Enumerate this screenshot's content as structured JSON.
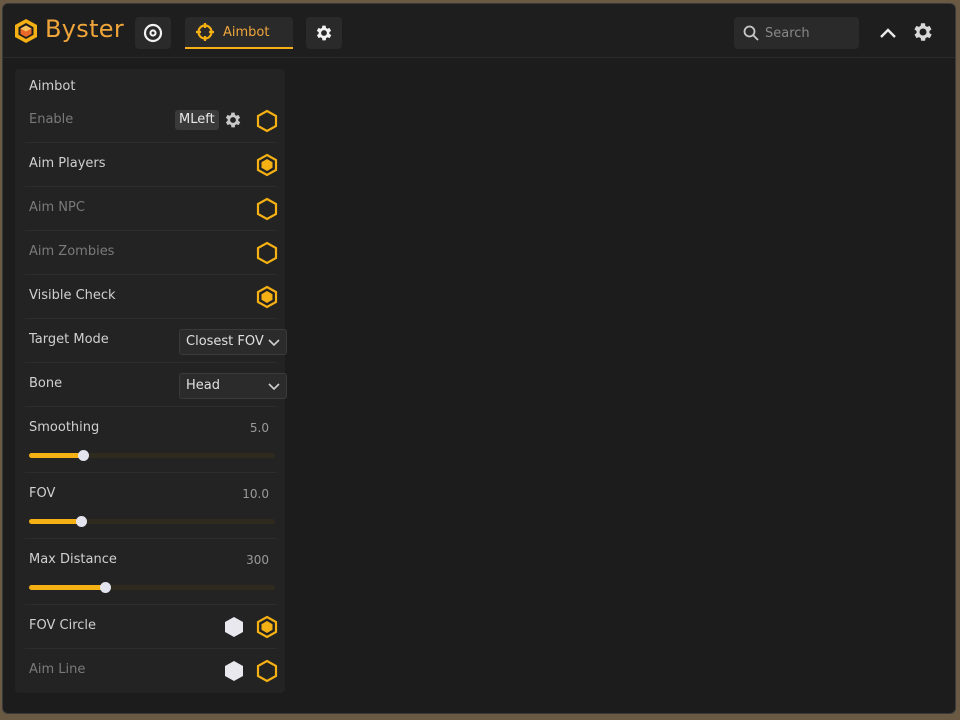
{
  "app": {
    "brand": "Byster",
    "accent_color": "#f5b014",
    "brand_color": "#f0a53b"
  },
  "topbar": {
    "tabs": [
      {
        "icon": "eye-icon",
        "label": ""
      },
      {
        "icon": "crosshair-icon",
        "label": "Aimbot",
        "active": true
      },
      {
        "icon": "gear-icon",
        "label": ""
      }
    ],
    "search": {
      "placeholder": "Search",
      "value": ""
    },
    "collapse_icon": "chevron-up-icon",
    "settings_icon": "gear-icon"
  },
  "panel": {
    "title": "Aimbot",
    "enable": {
      "label": "Enable",
      "keybind": "MLeft",
      "checked": false
    },
    "toggles": [
      {
        "label": "Aim Players",
        "checked": true
      },
      {
        "label": "Aim NPC",
        "checked": false
      },
      {
        "label": "Aim Zombies",
        "checked": false
      },
      {
        "label": "Visible Check",
        "checked": true
      }
    ],
    "dropdowns": [
      {
        "label": "Target Mode",
        "value": "Closest FOV"
      },
      {
        "label": "Bone",
        "value": "Head"
      }
    ],
    "sliders": [
      {
        "label": "Smoothing",
        "value": "5.0",
        "fraction": 0.22
      },
      {
        "label": "FOV",
        "value": "10.0",
        "fraction": 0.21
      },
      {
        "label": "Max Distance",
        "value": "300",
        "fraction": 0.31
      }
    ],
    "color_toggles": [
      {
        "label": "FOV Circle",
        "color": "#e8e8ee",
        "checked": true
      },
      {
        "label": "Aim Line",
        "color": "#e8e8ee",
        "checked": false
      }
    ]
  }
}
